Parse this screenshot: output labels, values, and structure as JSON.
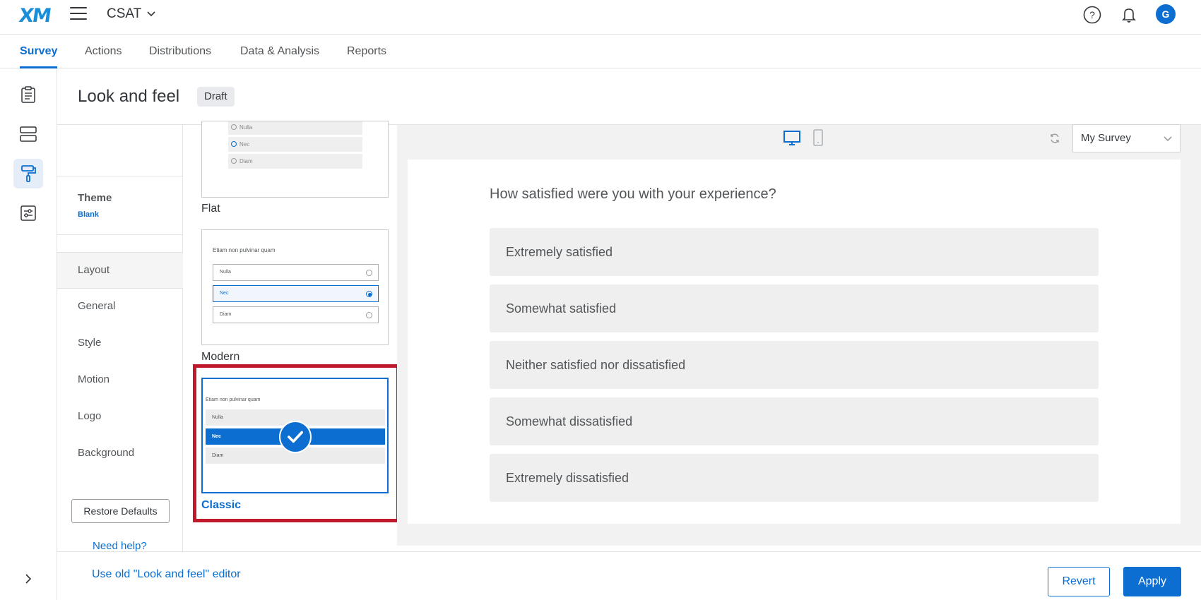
{
  "app": {
    "logo": "XM",
    "project": "CSAT"
  },
  "nav": {
    "tabs": [
      {
        "label": "Survey"
      },
      {
        "label": "Actions"
      },
      {
        "label": "Distributions"
      },
      {
        "label": "Data & Analysis"
      },
      {
        "label": "Reports"
      }
    ]
  },
  "user": {
    "avatar_initial": "G"
  },
  "header": {
    "title": "Look and feel",
    "badge": "Draft"
  },
  "settings": {
    "theme_label": "Theme",
    "theme_value": "Blank",
    "items": [
      {
        "label": "Layout"
      },
      {
        "label": "General"
      },
      {
        "label": "Style"
      },
      {
        "label": "Motion"
      },
      {
        "label": "Logo"
      },
      {
        "label": "Background"
      }
    ],
    "restore_label": "Restore Defaults",
    "help_label": "Need help?"
  },
  "layouts": {
    "flat": {
      "name": "Flat",
      "options": [
        "Nulla",
        "Nec",
        "Diam"
      ]
    },
    "modern": {
      "name": "Modern",
      "question": "Etiam non pulvinar quam",
      "options": [
        "Nulla",
        "Nec",
        "Diam"
      ]
    },
    "classic": {
      "name": "Classic",
      "question": "Etiam non pulvinar quam",
      "options": [
        "Nulla",
        "Nec",
        "Diam"
      ]
    },
    "selected": "Classic"
  },
  "preview": {
    "survey_select": "My Survey",
    "question": "How satisfied were you with your experience?",
    "answers": [
      "Extremely satisfied",
      "Somewhat satisfied",
      "Neither satisfied nor dissatisfied",
      "Somewhat dissatisfied",
      "Extremely dissatisfied"
    ]
  },
  "footer": {
    "old_editor_link": "Use old \"Look and feel\" editor",
    "revert_label": "Revert",
    "apply_label": "Apply"
  },
  "colors": {
    "accent": "#0b6ed0",
    "highlight": "#c0192b"
  }
}
